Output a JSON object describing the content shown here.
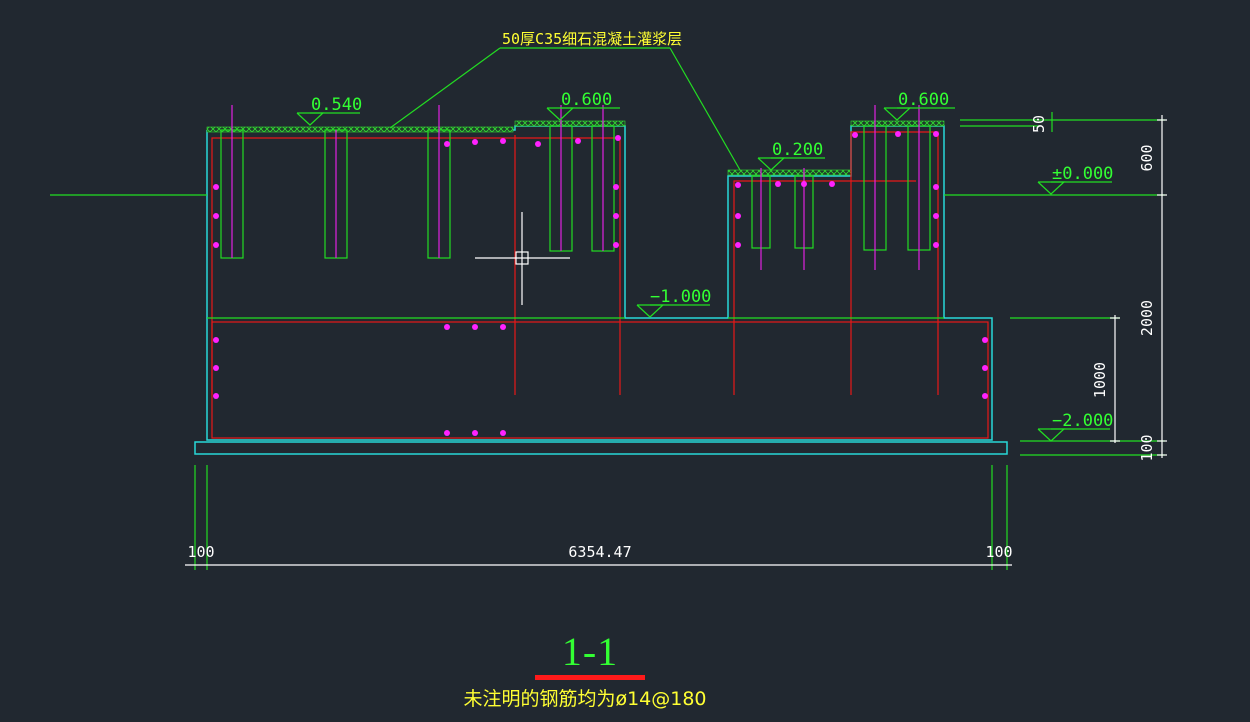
{
  "labels": {
    "grout_note": "50厚C35细石混凝土灌浆层",
    "elev_0540": "0.540",
    "elev_0600_left": "0.600",
    "elev_0200": "0.200",
    "elev_0600_right": "0.600",
    "elev_m1000": "−1.000",
    "elev_pm0000": "±0.000",
    "elev_m2000": "−2.000"
  },
  "dimensions": {
    "d50": "50",
    "d600": "600",
    "d2000": "2000",
    "d1000": "1000",
    "d100_right": "100",
    "d100_left": "100",
    "d_total": "6354.47",
    "d100_bottom_right": "100"
  },
  "section_title": "1-1",
  "note": "未注明的钢筋均为ø14@180",
  "colors": {
    "background": "#212830",
    "cyan_outline": "#28d7d7",
    "red_rebar": "#e81818",
    "green_lines": "#22dd22",
    "magenta_dots": "#ff22ff",
    "yellow_text": "#ffff33",
    "crosshair": "#ffffff"
  }
}
